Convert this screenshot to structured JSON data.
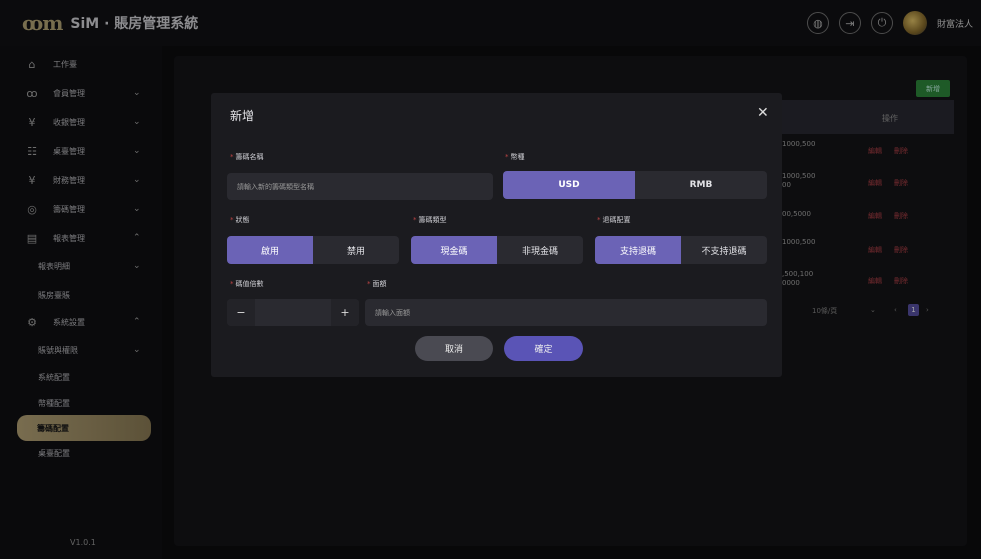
{
  "header": {
    "logo_mark": "ꝏm",
    "logo_text": "SiM · 賬房管理系統",
    "username": "財富法人",
    "icons": [
      "globe-icon",
      "logout-icon",
      "power-icon"
    ]
  },
  "sidebar": {
    "items": [
      {
        "label": "工作臺",
        "icon": "⌂",
        "chevron": ""
      },
      {
        "label": "會員管理",
        "icon": "ꝏ",
        "chevron": "⌄"
      },
      {
        "label": "收銀管理",
        "icon": "¥",
        "chevron": "⌄"
      },
      {
        "label": "桌臺管理",
        "icon": "☷",
        "chevron": "⌄"
      },
      {
        "label": "財務管理",
        "icon": "¥",
        "chevron": "⌄"
      },
      {
        "label": "籌碼管理",
        "icon": "◎",
        "chevron": "⌄"
      },
      {
        "label": "報表管理",
        "icon": "▤",
        "chevron": "⌃"
      },
      {
        "label": "報表明細",
        "icon": "",
        "chevron": "⌄"
      },
      {
        "label": "賬房臺賬",
        "icon": "",
        "chevron": ""
      },
      {
        "label": "系統設置",
        "icon": "⚙",
        "chevron": "⌃"
      },
      {
        "label": "賬號與權限",
        "icon": "",
        "chevron": "⌄"
      },
      {
        "label": "系統配置",
        "icon": "",
        "chevron": ""
      },
      {
        "label": "幣種配置",
        "icon": "",
        "chevron": ""
      },
      {
        "label": "籌碼配置",
        "icon": "",
        "chevron": ""
      },
      {
        "label": "桌臺配置",
        "icon": "",
        "chevron": ""
      }
    ],
    "version": "V1.0.1"
  },
  "background": {
    "add_label": "新增",
    "column_header": "操作",
    "rows": [
      {
        "value": "1000,500",
        "edit": "編輯",
        "delete": "刪除"
      },
      {
        "value": "1000,500\n00",
        "edit": "編輯",
        "delete": "刪除"
      },
      {
        "value": "00,5000",
        "edit": "編輯",
        "delete": "刪除"
      },
      {
        "value": "1000,500",
        "edit": "編輯",
        "delete": "刪除"
      },
      {
        "value": ",500,100\n0000",
        "edit": "編輯",
        "delete": "刪除"
      }
    ],
    "pager": {
      "page_size": "10條/頁",
      "page": "1"
    }
  },
  "modal": {
    "title": "新增",
    "close": "✕",
    "chip_name_label": "籌碼名稱",
    "chip_name_placeholder": "請輸入新的籌碼類型名稱",
    "currency_label": "幣種",
    "currency_options": [
      "USD",
      "RMB"
    ],
    "status_label": "狀態",
    "status_options": [
      "啟用",
      "禁用"
    ],
    "chip_type_label": "籌碼類型",
    "chip_type_options": [
      "現金碼",
      "非現金碼"
    ],
    "refund_label": "退碼配置",
    "refund_options": [
      "支持退碼",
      "不支持退碼"
    ],
    "multiplier_label": "碼值倍數",
    "face_value_label": "面額",
    "face_value_placeholder": "請輸入面額",
    "cancel_label": "取消",
    "confirm_label": "確定",
    "accent_color": "#6b63b6"
  }
}
